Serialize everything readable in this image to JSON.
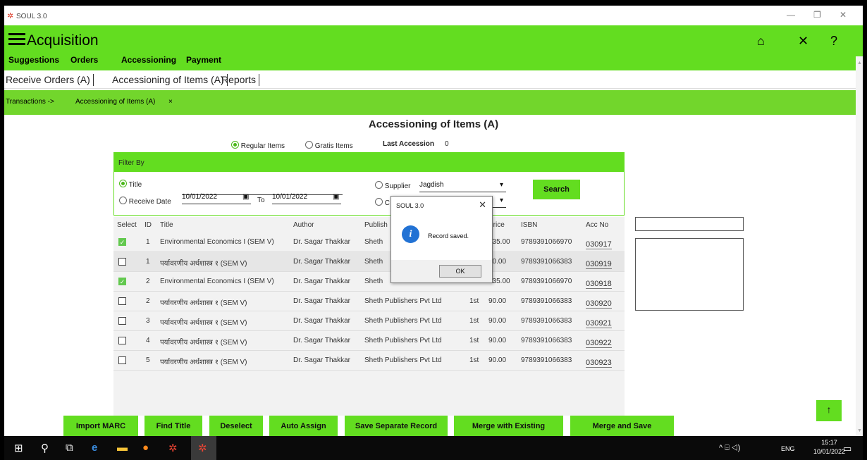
{
  "window": {
    "title": "SOUL 3.0"
  },
  "header": {
    "title": "Acquisition"
  },
  "menu": [
    "Suggestions",
    "Orders",
    "Accessioning",
    "Payment"
  ],
  "tabs": [
    "Receive Orders (A)",
    "Accessioning of Items (A)",
    "Reports"
  ],
  "breadcrumb": {
    "root": "Transactions ->",
    "current": "Accessioning of Items (A)",
    "close": "×"
  },
  "page": {
    "title": "Accessioning of Items (A)",
    "regular_label": "Regular Items",
    "gratis_label": "Gratis Items",
    "last_accession_label": "Last Accession",
    "last_accession_value": "0"
  },
  "filter": {
    "heading": "Filter By",
    "title_label": "Title",
    "receive_date_label": "Receive Date",
    "date_from": "10/01/2022",
    "to_label": "To",
    "date_to": "10/01/2022",
    "supplier_label": "Supplier",
    "supplier_value": "Jagdish",
    "second_option_letter": "C",
    "search_label": "Search"
  },
  "table": {
    "headers": [
      "Select",
      "ID",
      "Title",
      "Author",
      "Publish",
      "Price",
      "ISBN",
      "Acc No"
    ],
    "rows": [
      {
        "checked": true,
        "id": "1",
        "title": "Environmental Economics I (SEM V)",
        "author": "Dr. Sagar Thakkar",
        "publisher": "Sheth",
        "edition": "",
        "price": "135.00",
        "isbn": "9789391066970",
        "acc": "030917"
      },
      {
        "checked": false,
        "id": "1",
        "title": "पर्यावरणीय अर्थशास्त्र १ (SEM V)",
        "author": "Dr. Sagar Thakkar",
        "publisher": "Sheth",
        "edition": "",
        "price": "90.00",
        "isbn": "9789391066383",
        "acc": "030919"
      },
      {
        "checked": true,
        "id": "2",
        "title": "Environmental Economics I (SEM V)",
        "author": "Dr. Sagar Thakkar",
        "publisher": "Sheth",
        "edition": "",
        "price": "135.00",
        "isbn": "9789391066970",
        "acc": "030918"
      },
      {
        "checked": false,
        "id": "2",
        "title": "पर्यावरणीय अर्थशास्त्र १ (SEM V)",
        "author": "Dr. Sagar Thakkar",
        "publisher": "Sheth Publishers Pvt Ltd",
        "edition": "1st",
        "price": "90.00",
        "isbn": "9789391066383",
        "acc": "030920"
      },
      {
        "checked": false,
        "id": "3",
        "title": "पर्यावरणीय अर्थशास्त्र १ (SEM V)",
        "author": "Dr. Sagar Thakkar",
        "publisher": "Sheth Publishers Pvt Ltd",
        "edition": "1st",
        "price": "90.00",
        "isbn": "9789391066383",
        "acc": "030921"
      },
      {
        "checked": false,
        "id": "4",
        "title": "पर्यावरणीय अर्थशास्त्र १ (SEM V)",
        "author": "Dr. Sagar Thakkar",
        "publisher": "Sheth Publishers Pvt Ltd",
        "edition": "1st",
        "price": "90.00",
        "isbn": "9789391066383",
        "acc": "030922"
      },
      {
        "checked": false,
        "id": "5",
        "title": "पर्यावरणीय अर्थशास्त्र १ (SEM V)",
        "author": "Dr. Sagar Thakkar",
        "publisher": "Sheth Publishers Pvt Ltd",
        "edition": "1st",
        "price": "90.00",
        "isbn": "9789391066383",
        "acc": "030923"
      }
    ]
  },
  "dialog": {
    "title": "SOUL 3.0",
    "message": "Record saved.",
    "ok_label": "OK"
  },
  "buttons": [
    "Import MARC",
    "Find Title",
    "Deselect",
    "Auto Assign",
    "Save Separate Record",
    "Merge with Existing",
    "Merge and Save"
  ],
  "taskbar": {
    "lang": "ENG",
    "time": "15:17",
    "date": "10/01/2022"
  },
  "colors": {
    "accent": "#63dd20",
    "info_blue": "#2272d4"
  }
}
